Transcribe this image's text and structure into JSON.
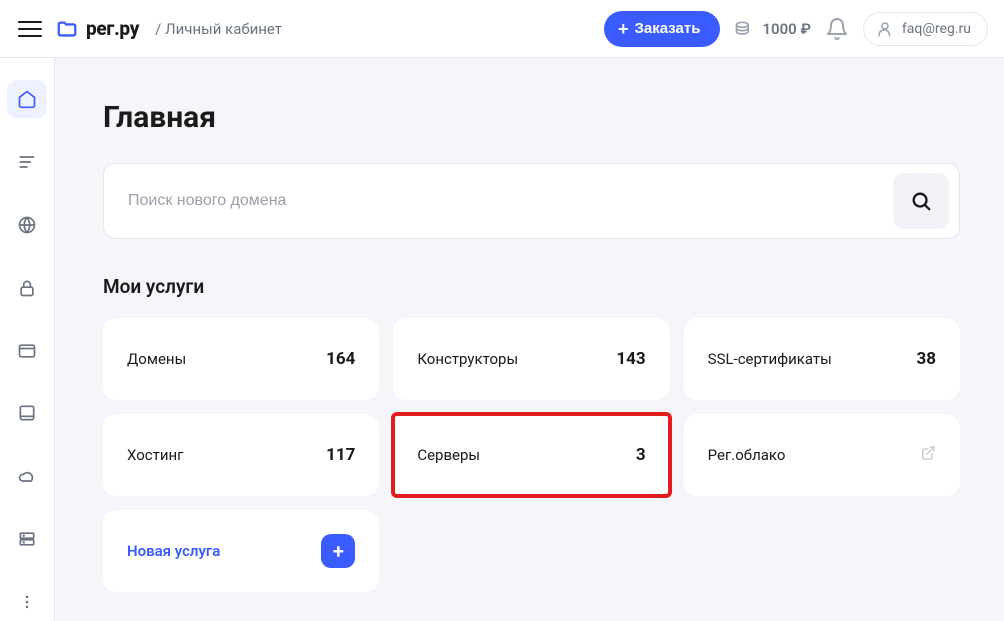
{
  "header": {
    "logo_text": "рег.ру",
    "breadcrumb": "/ Личный кабинет",
    "order_label": "Заказать",
    "balance": "1000 ₽",
    "user_email": "faq@reg.ru"
  },
  "page": {
    "title": "Главная",
    "search_placeholder": "Поиск нового домена",
    "section_title": "Мои услуги"
  },
  "services": [
    {
      "label": "Домены",
      "count": "164"
    },
    {
      "label": "Конструкторы",
      "count": "143"
    },
    {
      "label": "SSL-сертификаты",
      "count": "38"
    },
    {
      "label": "Хостинг",
      "count": "117"
    },
    {
      "label": "Серверы",
      "count": "3",
      "highlight": true
    },
    {
      "label": "Рег.облако",
      "external": true
    }
  ],
  "new_service_label": "Новая услуга"
}
